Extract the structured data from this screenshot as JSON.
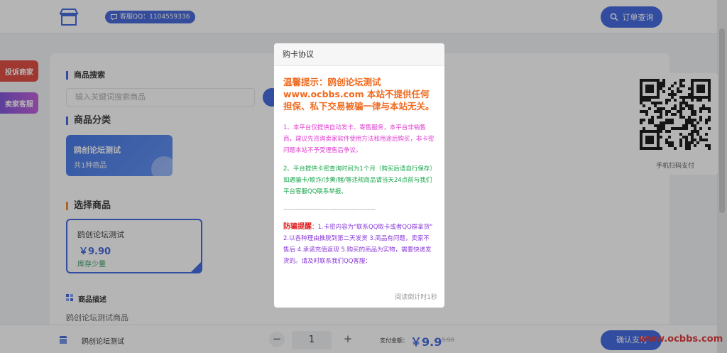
{
  "header": {
    "qq_label": "客服QQ：1104559336",
    "order_query": "订单查询"
  },
  "side_tags": {
    "complaint": "投诉商家",
    "service": "卖家客服"
  },
  "search": {
    "section_title": "商品搜索",
    "placeholder": "输入关键词搜索商品"
  },
  "category": {
    "section_title": "商品分类",
    "name": "鸥创论坛测试",
    "count": "共1种商品"
  },
  "product": {
    "section_title": "选择商品",
    "name": "鸥创论坛测试",
    "price": "￥9.90",
    "stock": "库存少量"
  },
  "description": {
    "section_title": "商品描述",
    "text": "鸥创论坛测试商品"
  },
  "qr": {
    "label": "手机扫码支付"
  },
  "bottom": {
    "product_name": "鸥创论坛测试",
    "minus": "−",
    "quantity": "1",
    "plus": "+",
    "total_label": "支付金额：",
    "total_price": "￥9.9",
    "old_price": "9.90",
    "pay_button": "确认支付"
  },
  "watermark": "www.ocbbs.com",
  "modal": {
    "title": "购卡协议",
    "warning": "温馨提示：鸥创论坛测试 www.ocbbs.com 本站不提供任何担保、私下交易被骗一律与本站无关。",
    "para1": "1、本平台仅提供自动发卡、寄售服务，本平台非销售商，建议先咨询卖家软件使用方法和用途后购买，非卡密问题本站不予受理售后争议。",
    "para2": "2、平台提供卡密查询时间为1个月（购买后请自行保存）如遇骗卡/欺诈/涉黄/赌/等违规商品请当天24点前与我们平台客服QQ联系举报。",
    "divider": "-----------------------------------------------",
    "fraud_lead": "防骗提醒",
    "fraud_text": "：1.卡密内容为\"联系QQ取卡或者QQ群拿货\" 2.以各种理由推脱到第二天发货 3.商品有问题，卖家不售后 4.承诺充值返现 5.购买的商品为实物，需要快递发货的。请及时联系我们QQ客服：",
    "countdown": "阅读倒计时1秒"
  },
  "colors": {
    "primary": "#3c63e0",
    "warning": "#f06a1e",
    "complaint": "#e0453d"
  }
}
